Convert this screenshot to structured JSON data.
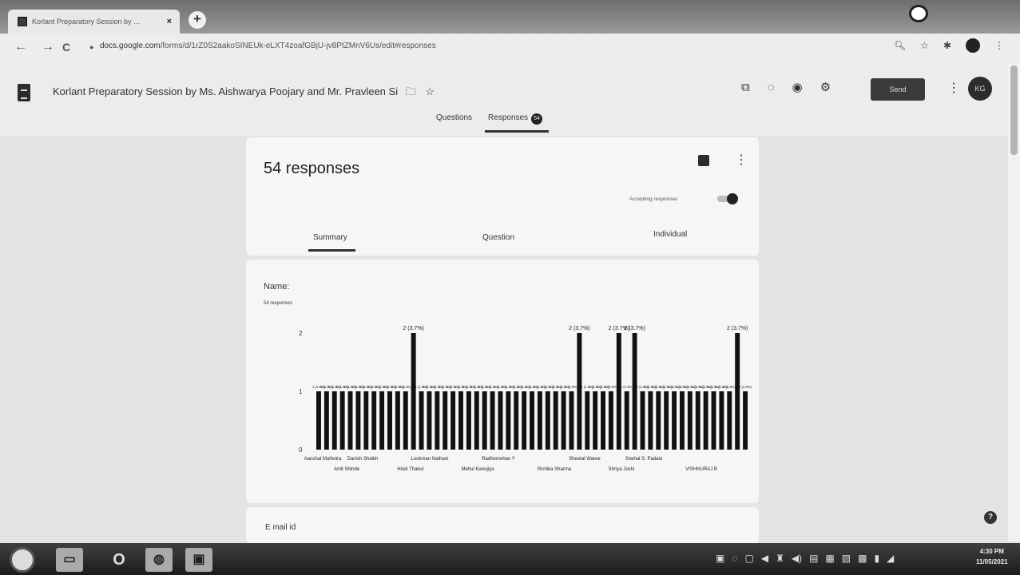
{
  "browser": {
    "tab_title": "Korlant Preparatory Session by ...",
    "tab_close": "×",
    "new_tab": "+",
    "nav_back": "←",
    "nav_forward": "→",
    "nav_reload": "C",
    "url_domain": "docs.google.com",
    "url_path": "/forms/d/1rZ0S2aakoSINEUk-eLXT4zoafGBjU-jv8PtZMnV6Us/edit#responses"
  },
  "header": {
    "title": "Korlant Preparatory Session by Ms. Aishwarya Poojary and Mr. Pravleen Si",
    "send_label": "Send",
    "avatar_initials": "KG",
    "tabs": {
      "questions": "Questions",
      "responses": "Responses",
      "responses_count": "54"
    }
  },
  "summary": {
    "count_title": "54 responses",
    "accepting_label": "Accepting responses",
    "subtabs": {
      "summary": "Summary",
      "question": "Question",
      "individual": "Individual"
    }
  },
  "name_question": {
    "title": "Name:",
    "count": "54 responses"
  },
  "email_question": {
    "title": "E mail id"
  },
  "taskbar": {
    "clock_time": "4:30 PM",
    "clock_date": "11/05/2021"
  },
  "colors": {
    "bar": "#111111",
    "page_bg": "#e6e3e4",
    "card_bg": "#f7f6f6"
  },
  "chart_data": {
    "type": "bar",
    "yticks": [
      0,
      1,
      2
    ],
    "ylim": [
      0,
      2
    ],
    "values": [
      1,
      1,
      1,
      1,
      1,
      1,
      1,
      1,
      1,
      1,
      1,
      1,
      2,
      1,
      1,
      1,
      1,
      1,
      1,
      1,
      1,
      1,
      1,
      1,
      1,
      1,
      1,
      1,
      1,
      1,
      1,
      1,
      1,
      2,
      1,
      1,
      1,
      1,
      2,
      1,
      2,
      1,
      1,
      1,
      1,
      1,
      1,
      1,
      1,
      1,
      1,
      1,
      1,
      2,
      1
    ],
    "value_labels_one": "1 (1.9%)",
    "value_labels_two": "2 (3.7%)",
    "x_labels_row1": [
      "Aanchal Malhotra",
      "Danish Shaikh",
      "Lookman Nathani",
      "Radhemohan Y",
      "Sheetal Waree",
      "Snehal S. Padale"
    ],
    "x_labels_row2": [
      "Amit Shinde",
      "Hitali Thakur",
      "Mehul Kanojiya",
      "Rishika Sharma",
      "Shriya Joshi",
      "VISHNURAJ B"
    ]
  }
}
